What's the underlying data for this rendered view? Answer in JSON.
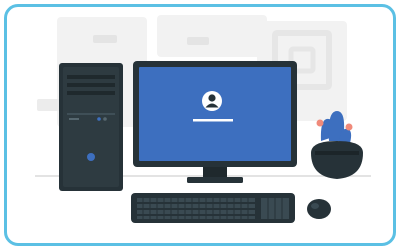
{
  "illustration": {
    "subject": "desktop-computer-login",
    "colors": {
      "frame_border": "#5bc0e4",
      "screen": "#3d6fbf",
      "dark": "#263238",
      "darker": "#1c2529",
      "background_shapes": "#f1f1f1",
      "cactus": "#3d6fbf",
      "cactus_flower": "#f08a7a",
      "power_led": "#3d6fbf",
      "user_icon": "#ffffff"
    },
    "icons": [
      "user-icon",
      "password-field-line"
    ]
  }
}
